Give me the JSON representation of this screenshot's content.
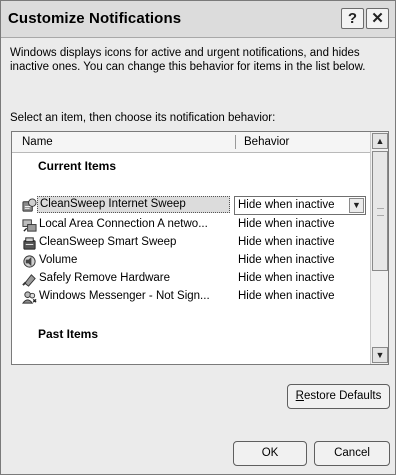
{
  "window": {
    "title": "Customize Notifications",
    "help_icon": "help-icon",
    "close_icon": "close-icon"
  },
  "description": "Windows displays icons for active and urgent notifications, and hides inactive ones. You can change this behavior for items in the list below.",
  "select_label": "Select an item, then choose its notification behavior:",
  "list": {
    "columns": [
      "Name",
      "Behavior"
    ],
    "groups": [
      "Current Items",
      "Past Items"
    ],
    "items": [
      {
        "name": "CleanSweep Internet Sweep",
        "behavior": "Hide when inactive",
        "icon": "internet-sweep-icon",
        "selected": true
      },
      {
        "name": "Local Area Connection A netwo...",
        "behavior": "Hide when inactive",
        "icon": "network-icon"
      },
      {
        "name": "CleanSweep Smart Sweep",
        "behavior": "Hide when inactive",
        "icon": "smart-sweep-icon"
      },
      {
        "name": "Volume",
        "behavior": "Hide when inactive",
        "icon": "volume-icon"
      },
      {
        "name": "Safely Remove Hardware",
        "behavior": "Hide when inactive",
        "icon": "hardware-icon"
      },
      {
        "name": "Windows Messenger - Not Sign...",
        "behavior": "Hide when inactive",
        "icon": "messenger-icon"
      }
    ]
  },
  "buttons": {
    "restore_first": "R",
    "restore_rest": "estore Defaults",
    "ok": "OK",
    "cancel": "Cancel"
  }
}
